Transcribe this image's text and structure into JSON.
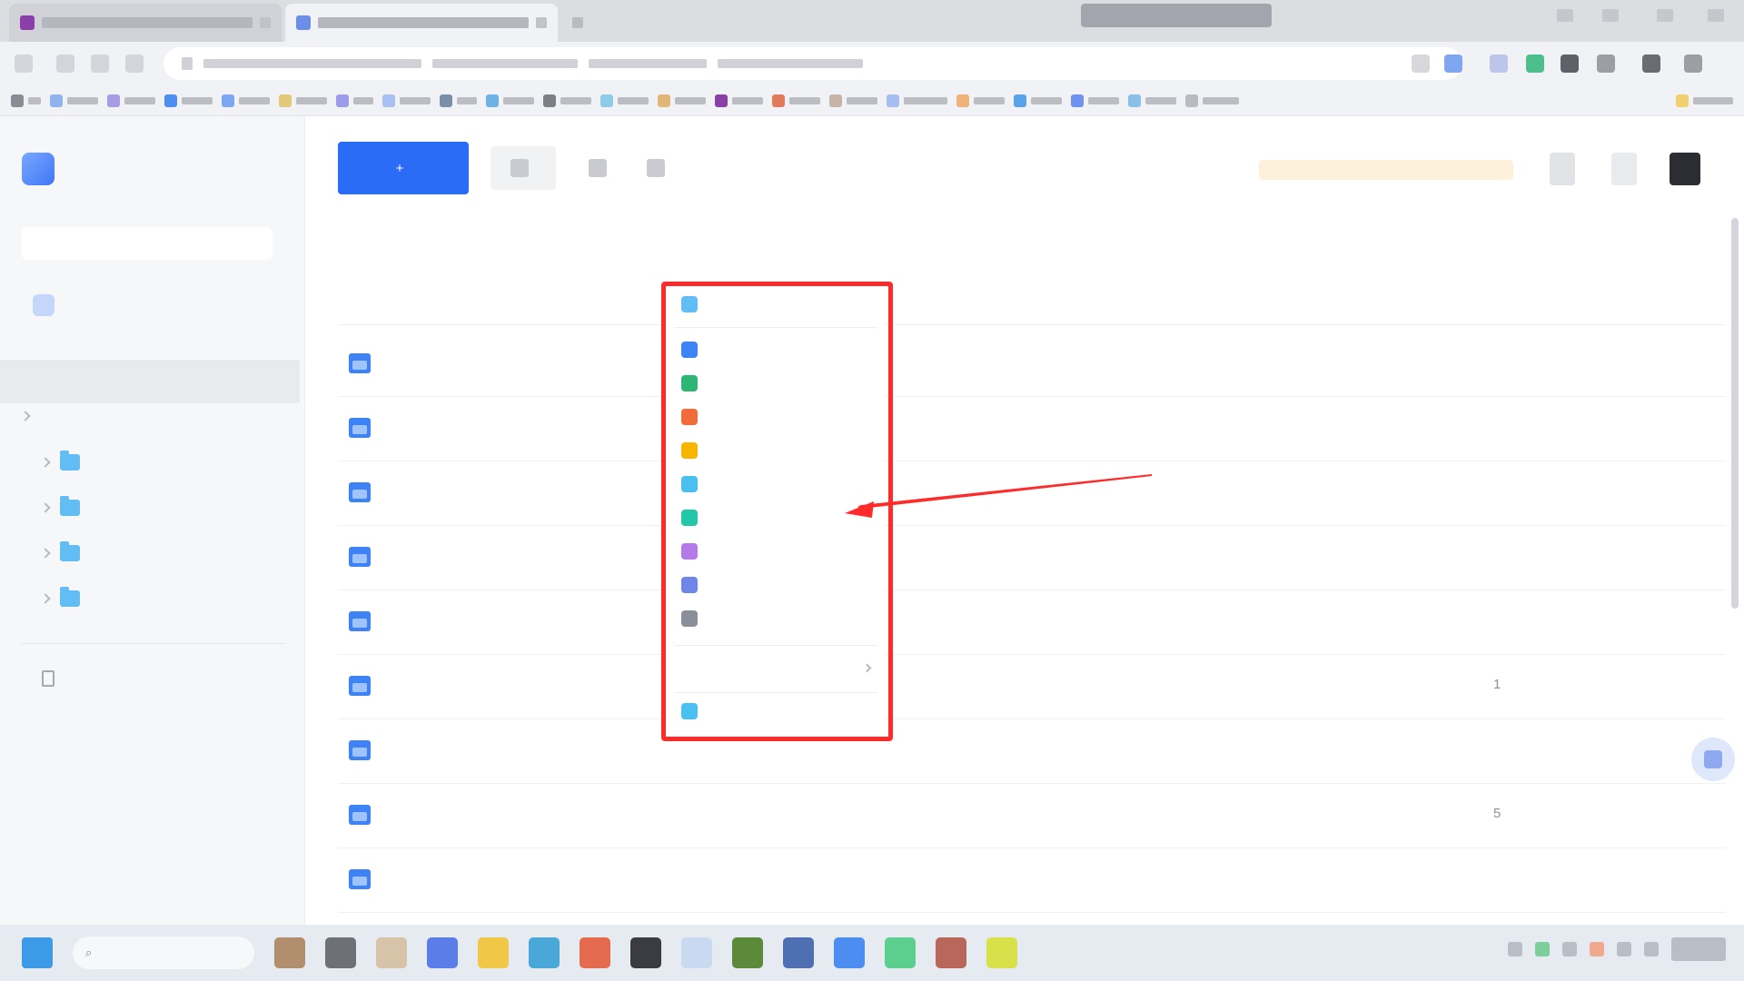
{
  "browser": {
    "tabs": [
      {
        "title": "",
        "favicon_color": "#8b3fa8"
      },
      {
        "title": "",
        "favicon_color": "#6b8ee8"
      }
    ],
    "url": "",
    "bookmarks_count": 24
  },
  "sidebar": {
    "app_name": "",
    "search_placeholder": "",
    "upgrade_label": "",
    "active_item": "",
    "group_label": "",
    "folders": [
      {
        "label": ""
      },
      {
        "label": ""
      },
      {
        "label": ""
      },
      {
        "label": ""
      }
    ],
    "trash_label": "",
    "storage": {
      "used": "",
      "total": ""
    }
  },
  "toolbar": {
    "new_label": "",
    "upload_label": "",
    "tool1_label": "",
    "tool2_label": "",
    "promo_text": ""
  },
  "breadcrumb": {
    "items": [
      "",
      ""
    ],
    "subtitle": ""
  },
  "table": {
    "columns": {
      "name": "",
      "size": "",
      "modified": ""
    },
    "rows": [
      {
        "name": "",
        "size": "",
        "modified": ""
      },
      {
        "name": "",
        "size": "",
        "modified": ""
      },
      {
        "name": "",
        "size": "",
        "modified": ""
      },
      {
        "name": "",
        "size": "",
        "modified": ""
      },
      {
        "name": "",
        "size": "",
        "modified": ""
      },
      {
        "name": "",
        "size": "",
        "modified": "1"
      },
      {
        "name": "",
        "size": "",
        "modified": ""
      },
      {
        "name": "",
        "size": "",
        "modified": "5"
      },
      {
        "name": "",
        "size": "",
        "modified": ""
      }
    ]
  },
  "new_menu": {
    "items": [
      {
        "label": "",
        "icon": "folder-icon",
        "color": "#62bdf5"
      },
      {
        "label": "",
        "icon": "doc-icon",
        "color": "#3d83f6"
      },
      {
        "label": "",
        "icon": "sheet-icon",
        "color": "#2bb673"
      },
      {
        "label": "",
        "icon": "slides-icon",
        "color": "#f26b3a"
      },
      {
        "label": "",
        "icon": "note-icon",
        "color": "#f7b500"
      },
      {
        "label": "",
        "icon": "form-icon",
        "color": "#4ac0f0"
      },
      {
        "label": "",
        "icon": "board-icon",
        "color": "#21c7a8"
      },
      {
        "label": "",
        "icon": "mindmap-icon",
        "color": "#b47ae8"
      },
      {
        "label": "",
        "icon": "flow-icon",
        "color": "#6f86e8"
      },
      {
        "label": "",
        "icon": "file-icon",
        "color": "#8a8f99"
      }
    ],
    "more_label": "",
    "template_label": "",
    "template_icon_color": "#4ac0f0",
    "highlight_color": "#ff2a2a"
  },
  "colors": {
    "primary": "#2a6cf6",
    "folder": "#3d83f6",
    "annotation": "#ff2a2a"
  }
}
